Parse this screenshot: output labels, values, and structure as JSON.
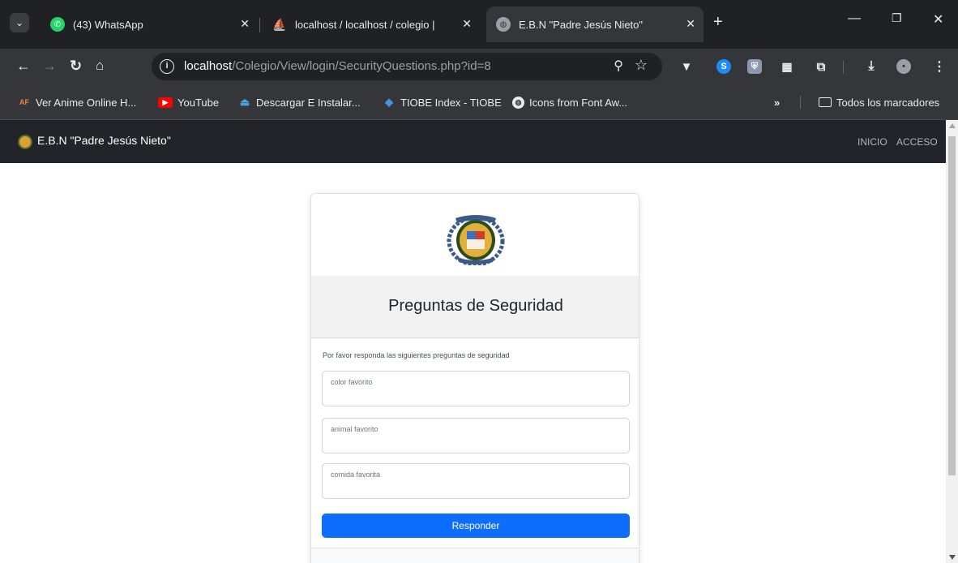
{
  "browser": {
    "tabs": [
      {
        "title": "(43) WhatsApp",
        "icon": "whatsapp-icon"
      },
      {
        "title": "localhost / localhost / colegio |",
        "icon": "phpmyadmin-icon"
      },
      {
        "title": "E.B.N \"Padre Jesús Nieto\"",
        "icon": "globe-icon",
        "active": true
      }
    ],
    "url_host": "localhost",
    "url_path": "/Colegio/View/login/SecurityQuestions.php?id=8",
    "bookmarks": [
      {
        "label": "Ver Anime Online H...",
        "icon": "animeflv-icon",
        "badge": "AF"
      },
      {
        "label": "YouTube",
        "icon": "youtube-icon"
      },
      {
        "label": "Descargar E Instalar...",
        "icon": "download-site-icon"
      },
      {
        "label": "TIOBE Index - TIOBE",
        "icon": "tiobe-icon"
      },
      {
        "label": "Icons from Font Aw...",
        "icon": "globe-icon"
      }
    ],
    "all_bookmarks": "Todos los marcadores",
    "more_bookmarks": "»"
  },
  "navbar": {
    "brand": "E.B.N \"Padre Jesús Nieto\"",
    "links": [
      "INICIO",
      "ACCESO"
    ]
  },
  "card": {
    "title": "Preguntas de Seguridad",
    "hint": "Por favor responda las siguientes preguntas de seguridad",
    "fields": [
      {
        "placeholder": "color favorito",
        "value": ""
      },
      {
        "placeholder": "animal favorito",
        "value": ""
      },
      {
        "placeholder": "comida favorita",
        "value": ""
      }
    ],
    "submit": "Responder"
  },
  "colors": {
    "navbar": "#212529",
    "primary": "#0d6efd",
    "card_header": "#f2f2f2",
    "browser_dark": "#202124"
  }
}
